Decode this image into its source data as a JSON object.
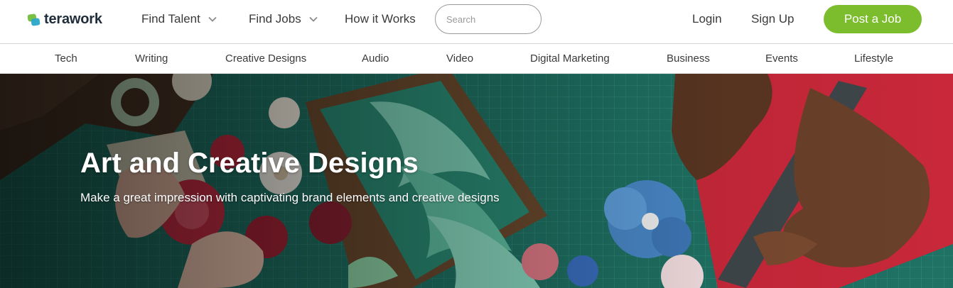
{
  "brand": {
    "name": "terawork",
    "colors": {
      "green": "#7cbd2d",
      "blue": "#2aa7c9",
      "dark": "#1f2d3a"
    }
  },
  "nav": {
    "find_talent": "Find Talent",
    "find_jobs": "Find Jobs",
    "how_it_works": "How it Works",
    "login": "Login",
    "sign_up": "Sign Up",
    "post_job": "Post a Job"
  },
  "search": {
    "placeholder": "Search",
    "value": ""
  },
  "categories": [
    "Tech",
    "Writing",
    "Creative Designs",
    "Audio",
    "Video",
    "Digital Marketing",
    "Business",
    "Events",
    "Lifestyle"
  ],
  "hero": {
    "title": "Art and Creative Designs",
    "subtitle": "Make a great impression with captivating brand elements and creative designs",
    "image_alt": "hero-craft-photo"
  },
  "icons": {
    "dropdown": "chevron-down-icon",
    "logo": "terawork-logo-icon"
  }
}
